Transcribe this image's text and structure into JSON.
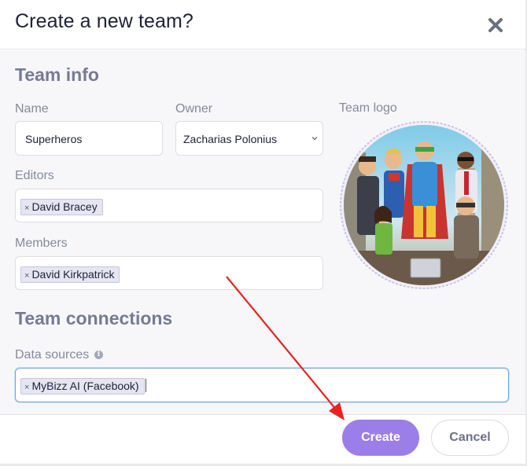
{
  "dialog": {
    "title": "Create a new team?",
    "close_icon": "close-icon"
  },
  "team_info": {
    "section_title": "Team info",
    "name": {
      "label": "Name",
      "value": "Superheros"
    },
    "owner": {
      "label": "Owner",
      "value": "Zacharias Polonius"
    },
    "editors": {
      "label": "Editors",
      "tags": [
        "David Bracey"
      ]
    },
    "members": {
      "label": "Members",
      "tags": [
        "David Kirkpatrick"
      ]
    },
    "logo": {
      "label": "Team logo",
      "image": "superhero-team-illustration"
    }
  },
  "team_connections": {
    "section_title": "Team connections",
    "data_sources": {
      "label": "Data sources",
      "info_icon": "info-icon",
      "tags": [
        "MyBizz AI (Facebook)"
      ]
    }
  },
  "tag_remove_glyph": "×",
  "footer": {
    "create_label": "Create",
    "cancel_label": "Cancel"
  },
  "colors": {
    "primary": "#9c7ee8",
    "annotation_arrow": "#e8231f"
  }
}
